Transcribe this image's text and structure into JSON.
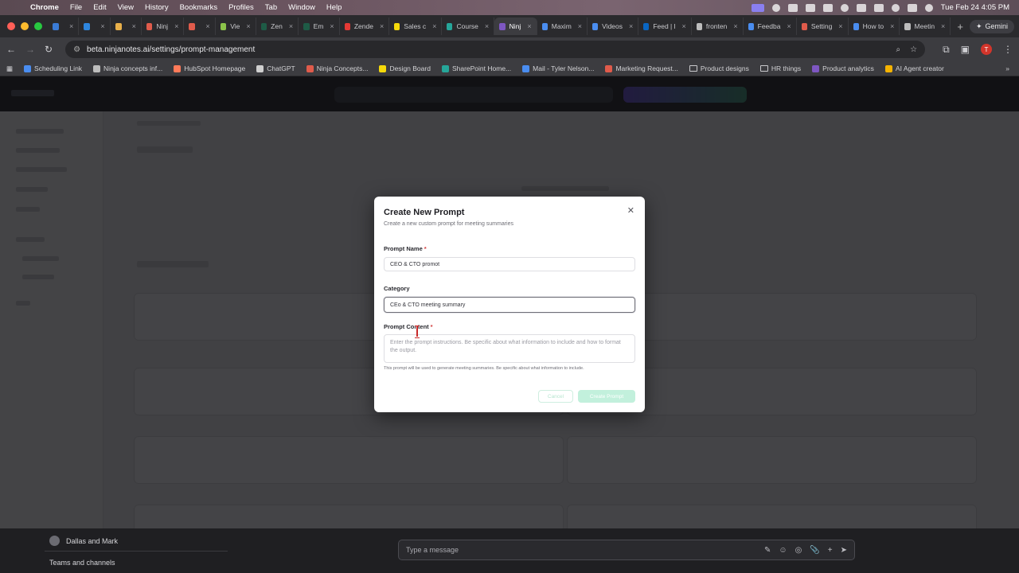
{
  "menubar": {
    "app": "Chrome",
    "items": [
      "File",
      "Edit",
      "View",
      "History",
      "Bookmarks",
      "Profiles",
      "Tab",
      "Window",
      "Help"
    ],
    "clock": "Tue Feb 24  4:05 PM"
  },
  "tabs": [
    {
      "label": "",
      "color": "#3a7bd5"
    },
    {
      "label": "",
      "color": "#2e86de"
    },
    {
      "label": "",
      "color": "#e8b04a"
    },
    {
      "label": "Ninj",
      "color": "#e05b4b"
    },
    {
      "label": "",
      "color": "#e05b4b"
    },
    {
      "label": "Vie",
      "color": "#8bc34a"
    },
    {
      "label": "Zen",
      "color": "#1e5b46"
    },
    {
      "label": "Em",
      "color": "#1e5b46"
    },
    {
      "label": "Zende",
      "color": "#e53935"
    },
    {
      "label": "Sales c",
      "color": "#f5d90a"
    },
    {
      "label": "Course",
      "color": "#26a69a"
    },
    {
      "label": "Ninj",
      "color": "#7e57c2",
      "active": true
    },
    {
      "label": "Maxim",
      "color": "#4a8df0"
    },
    {
      "label": "Videos",
      "color": "#4a8df0"
    },
    {
      "label": "Feed | l",
      "color": "#0a66c2"
    },
    {
      "label": "fronten",
      "color": "#bdbdbd"
    },
    {
      "label": "Feedba",
      "color": "#4a8df0"
    },
    {
      "label": "Setting",
      "color": "#e05b4b"
    },
    {
      "label": "How to",
      "color": "#4a8df0"
    },
    {
      "label": "Meetin",
      "color": "#bdbdbd"
    }
  ],
  "gemini_label": "Gemini",
  "address": {
    "url": "beta.ninjanotes.ai/settings/prompt-management"
  },
  "bookmarks": [
    {
      "label": "Scheduling Link",
      "color": "#4a8df0"
    },
    {
      "label": "Ninja concepts inf...",
      "color": "#bdbdbd"
    },
    {
      "label": "HubSpot Homepage",
      "color": "#ff7a59"
    },
    {
      "label": "ChatGPT",
      "color": "#cfcfcf"
    },
    {
      "label": "Ninja Concepts...",
      "color": "#e05b4b"
    },
    {
      "label": "Design Board",
      "color": "#f5d90a"
    },
    {
      "label": "SharePoint Home...",
      "color": "#26a69a"
    },
    {
      "label": "Mail - Tyler Nelson...",
      "color": "#4a8df0"
    },
    {
      "label": "Marketing Request...",
      "color": "#e05b4b"
    },
    {
      "label": "Product designs",
      "folder": true
    },
    {
      "label": "HR things",
      "folder": true
    },
    {
      "label": "Product analytics",
      "color": "#7e57c2"
    },
    {
      "label": "AI Agent creator",
      "color": "#f5b301"
    }
  ],
  "modal": {
    "title": "Create New Prompt",
    "subtitle": "Create a new custom prompt for meeting summaries",
    "name_label": "Prompt Name",
    "name_value": "CEO & CTO promot",
    "category_label": "Category",
    "category_value": "CEo & CTO meeting summary",
    "content_label": "Prompt Content",
    "content_placeholder": "Enter the prompt instructions. Be specific about what information to include and how to format the output.",
    "help": "This prompt will be used to generate meeting summaries. Be specific about what information to include.",
    "cancel": "Cancel",
    "create": "Create Prompt"
  },
  "teams": {
    "chat_name": "Dallas and Mark",
    "channels": "Teams and channels",
    "message_placeholder": "Type a message"
  }
}
